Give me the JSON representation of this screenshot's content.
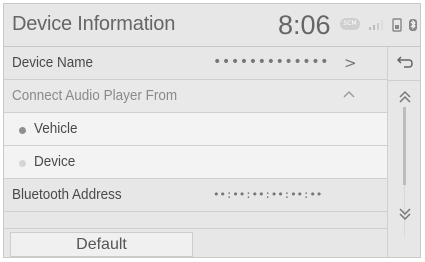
{
  "header": {
    "title": "Device Information",
    "clock": "8:06",
    "status_badge": "SCM"
  },
  "rows": {
    "device_name": {
      "label": "Device Name",
      "value": "•••••••••••••"
    },
    "connect_from": {
      "label": "Connect Audio Player From"
    },
    "option_vehicle": {
      "label": "Vehicle",
      "selected": true
    },
    "option_device": {
      "label": "Device",
      "selected": false
    },
    "bluetooth": {
      "label": "Bluetooth Address",
      "value": "••:••:••:••:••:••"
    }
  },
  "footer": {
    "default_label": "Default"
  },
  "icons": {
    "chevron": "chevron-right-icon",
    "collapse": "caret-up-icon",
    "back": "back-arrow-icon",
    "scroll_up": "double-chevron-up-icon",
    "scroll_down": "double-chevron-down-icon",
    "signal": "signal-icon",
    "phone": "phone-battery-icon",
    "bluetooth_status": "bluetooth-icon"
  },
  "colors": {
    "background": "#e7e7e7",
    "text": "#4a4a4a"
  }
}
